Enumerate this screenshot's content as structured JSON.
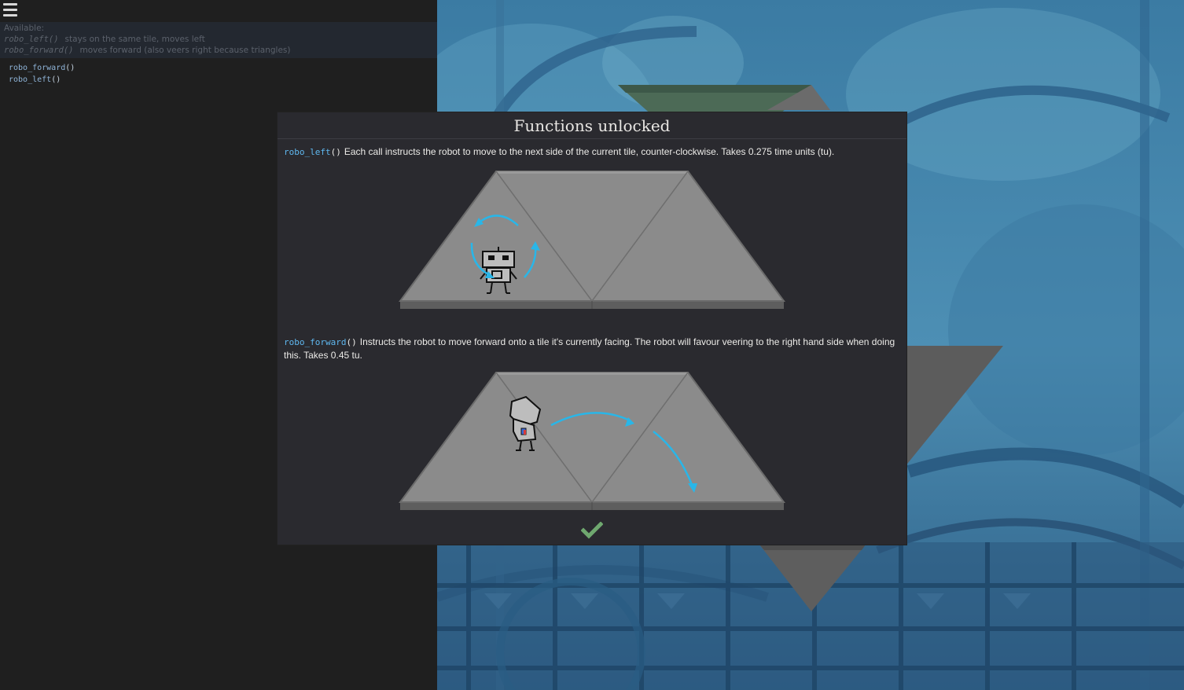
{
  "editor": {
    "menu_icon": "hamburger-menu-icon",
    "available": {
      "heading": "Available:",
      "items": [
        {
          "fn": "robo_left()",
          "desc": "stays on the same tile, moves left"
        },
        {
          "fn": "robo_forward()",
          "desc": "moves forward (also veers right because triangles)"
        }
      ]
    },
    "code": [
      {
        "fn": "robo_forward",
        "args": "()"
      },
      {
        "fn": "robo_left",
        "args": "()"
      }
    ]
  },
  "modal": {
    "title": "Functions unlocked",
    "entries": [
      {
        "fn": "robo_left",
        "args": "()",
        "description": "Each call instructs the robot to move to the next side of the current tile, counter-clockwise. Takes 0.275 time units (tu)."
      },
      {
        "fn": "robo_forward",
        "args": "()",
        "description": "Instructs the robot to move forward onto a tile it's currently facing. The robot will favour veering to the right hand side when doing this. Takes 0.45 tu."
      }
    ],
    "confirm_icon": "checkmark-icon"
  },
  "colors": {
    "function_name": "#5fb8f0",
    "arrow": "#29b6e8",
    "confirm": "#6fa86f",
    "modal_bg": "#2a2a2f",
    "editor_bg": "#1f1f1f"
  }
}
